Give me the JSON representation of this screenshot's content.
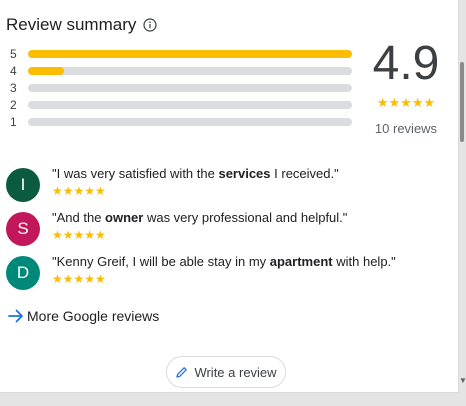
{
  "header": {
    "title": "Review summary"
  },
  "distribution": [
    {
      "label": "5",
      "fraction": 1.0
    },
    {
      "label": "4",
      "fraction": 0.11
    },
    {
      "label": "3",
      "fraction": 0.0
    },
    {
      "label": "2",
      "fraction": 0.0
    },
    {
      "label": "1",
      "fraction": 0.0
    }
  ],
  "rating": {
    "value": "4.9",
    "stars": "★★★★★",
    "count": "10 reviews"
  },
  "reviews": [
    {
      "initial": "I",
      "color": "#0b5b40",
      "before": "\"I was very satisfied with the ",
      "bold": "services",
      "after": " I received.\"",
      "stars": "★★★★★"
    },
    {
      "initial": "S",
      "color": "#c2185b",
      "before": "\"And the ",
      "bold": "owner",
      "after": " was very professional and helpful.\"",
      "stars": "★★★★★"
    },
    {
      "initial": "D",
      "color": "#00897b",
      "before": "\"Kenny Greif, I will be able stay in my ",
      "bold": "apartment",
      "after": " with help.\"",
      "stars": "★★★★★"
    }
  ],
  "more_link": {
    "label": "More Google reviews"
  },
  "write_button": {
    "label": "Write a review"
  },
  "colors": {
    "star": "#fbbc04",
    "track": "#dadce0",
    "link_arrow": "#1a73e8"
  }
}
